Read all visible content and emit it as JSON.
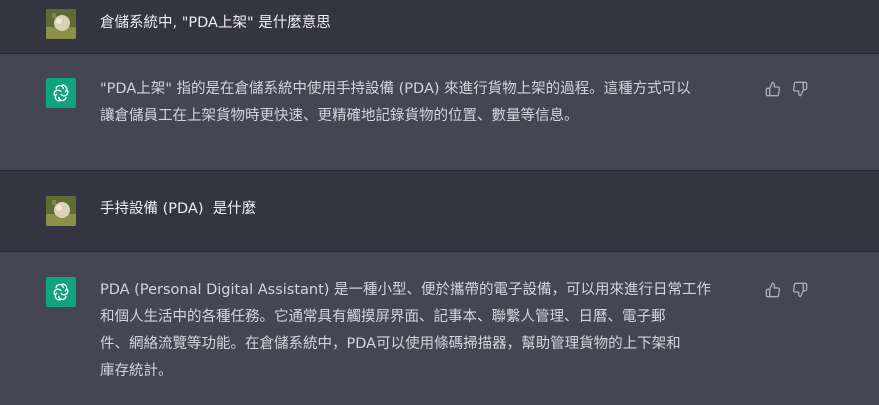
{
  "messages": [
    {
      "role": "user",
      "text": "倉儲系統中, \"PDA上架\" 是什麼意思"
    },
    {
      "role": "assistant",
      "text": "\"PDA上架\" 指的是在倉儲系統中使用手持設備 (PDA) 來進行貨物上架的過程。這種方式可以\n讓倉儲員工在上架貨物時更快速、更精確地記錄貨物的位置、數量等信息。"
    },
    {
      "role": "user",
      "text": "手持設備 (PDA)  是什麼"
    },
    {
      "role": "assistant",
      "text": "PDA (Personal Digital Assistant) 是一種小型、便於攜帶的電子設備，可以用來進行日常工作\n和個人生活中的各種任務。它通常具有觸摸屏界面、記事本、聯繫人管理、日曆、電子郵\n件、網絡流覽等功能。在倉儲系統中，PDA可以使用條碼掃描器，幫助管理貨物的上下架和\n庫存統計。"
    }
  ],
  "icons": {
    "user_avatar": "user-avatar-icon",
    "assistant_avatar": "openai-logo-icon",
    "thumbs_up": "thumbs-up-icon",
    "thumbs_down": "thumbs-down-icon"
  },
  "colors": {
    "user_bg": "#343541",
    "assistant_bg": "#444654",
    "assistant_avatar_bg": "#10a37f"
  }
}
